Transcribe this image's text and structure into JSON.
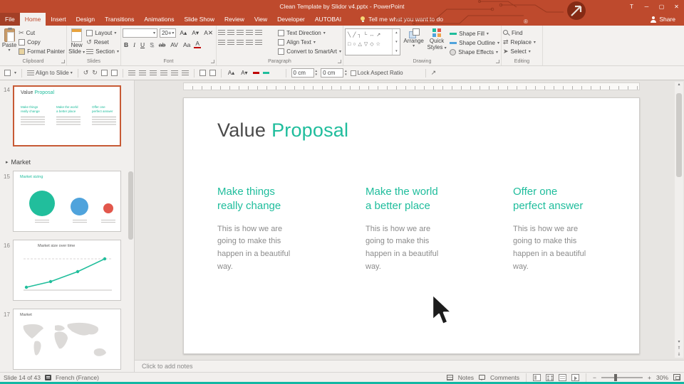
{
  "titlebar": {
    "title": "Clean Template by Slidor v4.pptx - PowerPoint",
    "t_button": "T"
  },
  "icons": {
    "dropdown": "▾",
    "minimize": "─",
    "maximize": "▢",
    "close": "✕",
    "scissors": "✂",
    "undo_rotate": "↺",
    "redo_rotate": "↻",
    "up": "▴",
    "down": "▾",
    "prev_slide": "⇑",
    "next_slide": "⇓",
    "replace": "⇄",
    "select_arrow": "➤",
    "minus": "−",
    "plus": "+",
    "nw_arrow": "↗",
    "registered": "®",
    "gallery_row1": "╲╱┐└↔↗",
    "gallery_row2": "□○△▽◇☆",
    "section_triangle": "▸",
    "grow_font": "A▴",
    "shrink_font": "A▾",
    "clear_format": "A✕"
  },
  "ribbon": {
    "tabs": [
      "File",
      "Home",
      "Insert",
      "Design",
      "Transitions",
      "Animations",
      "Slide Show",
      "Review",
      "View",
      "Developer",
      "AUTOBAI"
    ],
    "tell_me": "Tell me what you want to do",
    "share": "Share",
    "clipboard": {
      "label": "Clipboard",
      "paste": "Paste",
      "cut": "Cut",
      "copy": "Copy",
      "format_painter": "Format Painter"
    },
    "slides": {
      "label": "Slides",
      "new_slide_1": "New",
      "new_slide_2": "Slide",
      "layout": "Layout",
      "reset": "Reset",
      "section": "Section"
    },
    "font": {
      "label": "Font",
      "size": "20+",
      "bold": "B",
      "italic": "I",
      "underline": "U",
      "shadow": "S",
      "strike": "ab",
      "spacing": "AV",
      "case": "Aa",
      "color": "A"
    },
    "paragraph": {
      "label": "Paragraph",
      "text_direction": "Text Direction",
      "align_text": "Align Text",
      "smartart": "Convert to SmartArt"
    },
    "drawing": {
      "label": "Drawing",
      "arrange": "Arrange",
      "quick_1": "Quick",
      "quick_2": "Styles",
      "fill": "Shape Fill",
      "outline": "Shape Outline",
      "effects": "Shape Effects"
    },
    "editing": {
      "label": "Editing",
      "find": "Find",
      "replace": "Replace",
      "select": "Select"
    }
  },
  "toolbar2": {
    "align_to_slide": "Align to Slide",
    "width": "0 cm",
    "height": "0 cm",
    "lock_aspect": "Lock Aspect Ratio"
  },
  "panel": {
    "section": "Market",
    "slide14_num": "14",
    "slide15_num": "15",
    "slide16_num": "16",
    "slide17_num": "17",
    "slide15_title": "Market sizing",
    "slide16_title": "Market size over time",
    "slide17_title": "Market"
  },
  "slide": {
    "title_plain": "Value",
    "title_accent": "Proposal",
    "columns": [
      {
        "h1": "Make things",
        "h2": "really change",
        "body": "This is how we are going to make this happen in a beautiful way."
      },
      {
        "h1": "Make the world",
        "h2": "a better place",
        "body": "This is how we are going to make this happen in a beautiful way."
      },
      {
        "h1": "Offer one",
        "h2": "perfect answer",
        "body": "This is how we are going to make this happen in a beautiful way."
      }
    ]
  },
  "notes": {
    "placeholder": "Click to add notes"
  },
  "statusbar": {
    "slide_indicator": "Slide 14 of 43",
    "language": "French (France)",
    "notes_label": "Notes",
    "comments_label": "Comments",
    "zoom": "30%"
  },
  "colors": {
    "accent": "#BE4A2D",
    "teal": "#1FBD9C",
    "bottom_strip": "#12B7A3"
  }
}
